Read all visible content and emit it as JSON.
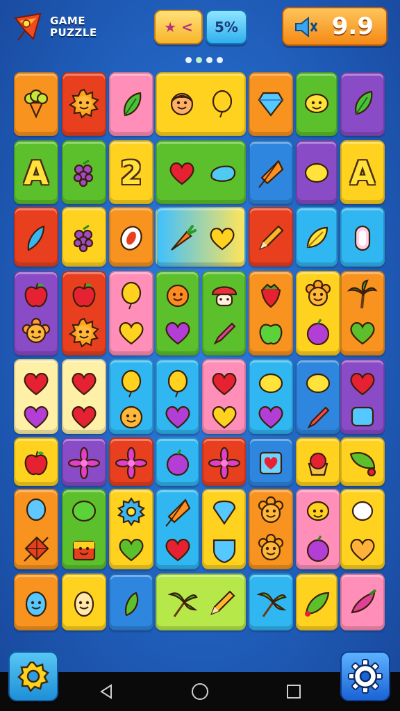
{
  "header": {
    "logo_line1": "GAME",
    "logo_line2": "PUZZLE",
    "stars_pill_text": "★ <",
    "percent_pill": "5%",
    "score": "9.9",
    "page_dots": 4,
    "active_dot": 2
  },
  "colors": {
    "orange": "#f7931e",
    "red": "#e8401f",
    "pink": "#ff8fb8",
    "yellow": "#ffd21f",
    "lightblue": "#30b6f0",
    "green": "#5cc02c",
    "purple": "#8a4bc6",
    "blue": "#2f86de",
    "cream": "#fff0a8"
  },
  "board": {
    "rows": [
      [
        "orange:broccoli",
        "red:sun-face",
        "pink:leaf",
        "yellow:face+lemon(w2)",
        "lightblue:gem",
        "green:lemon-face",
        "purple:leaf"
      ],
      [
        "green:letter-A",
        "green:grapes",
        "yellow:number-2",
        "green:heart+drop(w2)",
        "blue:kite",
        "purple:lemon",
        "yellow:letter-A"
      ],
      [
        "red:feather",
        "yellow:grapes",
        "orange:ring",
        "gradient:carrot+heart(w2)",
        "red:pencil",
        "lightblue:lemon",
        "lightblue:capsule"
      ],
      [
        "purple:apple/sun(h2)",
        "red:apple/sun(h2)",
        "pink:balloon/heart(h2)",
        "green:orange/heart(h2)",
        "green:mushroom/pencil(h2)",
        "orange:strawberry/apple(h2)",
        "yellow:flower/plum(h2)",
        "orange:palm/heart(h2)"
      ],
      [
        "cream:heart/heart(h2)",
        "cream:heart/heart(h2)",
        "lightblue:balloon/face(h2)",
        "lightblue:balloon/heart(h2)",
        "pink:heart/heart(h2)",
        "lightblue:lemon/heart(h2)",
        "blue:lemon/pencil(h2)",
        "purple:heart/square(h2)"
      ],
      [
        "yellow:apple",
        "purple:flower",
        "red:flower",
        "lightblue:plum",
        "red:flower",
        "blue:heart-box",
        "yellow:cupcake",
        "yellow:leaf"
      ],
      [
        "orange:balloon/kite(h2)",
        "green:bubble/cake(h2)",
        "yellow:gear/heart(h2)",
        "lightblue:kite/heart(h2)",
        "yellow:gem/gem(h2)",
        "orange:sun/sun(h2)",
        "pink:face/plum(h2)",
        "yellow:balloon/heart(h2)"
      ],
      [
        "orange:face",
        "yellow:egg",
        "blue:leaf",
        "green:palm+pencil(w2)",
        "lightblue:palm",
        "yellow:leaf",
        "pink:beet"
      ]
    ]
  },
  "footer": {
    "left_button": "hint-gear-icon",
    "right_button": "settings-gear-icon",
    "nav": [
      "back-icon",
      "home-icon",
      "recents-icon"
    ]
  }
}
